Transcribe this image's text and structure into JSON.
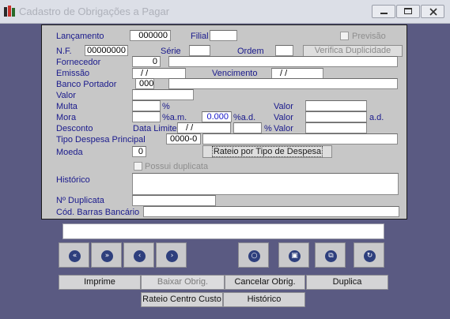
{
  "window": {
    "title": "Cadastro de Obrigações a Pagar",
    "minimize_icon": "minimize-icon",
    "maximize_icon": "maximize-icon",
    "close_icon": "close-icon"
  },
  "form": {
    "lancamento": {
      "label": "Lançamento",
      "value": "000000"
    },
    "filial": {
      "label": "Filial",
      "value": ""
    },
    "previsao": {
      "label": "Previsão",
      "checked": false
    },
    "nf": {
      "label": "N.F.",
      "value": "00000000"
    },
    "serie": {
      "label": "Série",
      "value": ""
    },
    "ordem": {
      "label": "Ordem",
      "value": ""
    },
    "verifica_label": "Verifica Duplicidade",
    "fornecedor": {
      "label": "Fornecedor",
      "code": "0",
      "name": ""
    },
    "emissao": {
      "label": "Emissão",
      "value": "/ /"
    },
    "vencimento": {
      "label": "Vencimento",
      "value": "/ /"
    },
    "banco": {
      "label": "Banco Portador",
      "code": "000",
      "name": ""
    },
    "valor": {
      "label": "Valor",
      "value": ""
    },
    "multa": {
      "label": "Multa",
      "value": "",
      "pct": "%",
      "valor_label": "Valor",
      "valor_value": ""
    },
    "mora": {
      "label": "Mora",
      "value": "",
      "am": "%a.m.",
      "rate": "0.000",
      "ad": "%a.d.",
      "valor_label": "Valor",
      "valor_value": "",
      "ad2": "a.d."
    },
    "desconto": {
      "label": "Desconto",
      "data_limite_label": "Data Limite",
      "data_limite_value": "/ /",
      "pct_value": "",
      "pct": "%",
      "valor_label": "Valor",
      "valor_value": ""
    },
    "tipo_despesa": {
      "label": "Tipo Despesa Principal",
      "code": "0000-0",
      "name": ""
    },
    "rateio_tipo_label": "Rateio por Tipo de Despesa",
    "moeda": {
      "label": "Moeda",
      "value": "0"
    },
    "possui_duplicata": {
      "label": "Possui duplicata",
      "checked": false
    },
    "historico": {
      "label": "Histórico",
      "value": ""
    },
    "n_duplicata": {
      "label": "Nº Duplicata",
      "value": ""
    },
    "cod_barras": {
      "label": "Cód. Barras Bancário",
      "value": ""
    }
  },
  "status_text": "",
  "nav_buttons": {
    "first": {
      "icon": "first-record-icon",
      "glyph": "«"
    },
    "next_page": {
      "icon": "fast-forward-icon",
      "glyph": "»"
    },
    "prev": {
      "icon": "previous-icon",
      "glyph": "‹"
    },
    "next": {
      "icon": "next-icon",
      "glyph": "›"
    },
    "new": {
      "icon": "new-record-icon",
      "glyph": "○"
    },
    "delete": {
      "icon": "delete-record-icon",
      "glyph": "▣"
    },
    "edit": {
      "icon": "edit-record-icon",
      "glyph": "⧉"
    },
    "refresh": {
      "icon": "refresh-icon",
      "glyph": "↻"
    }
  },
  "action_buttons": {
    "imprime": "Imprime",
    "baixar": "Baixar Obrig.",
    "cancelar": "Cancelar Obrig.",
    "duplica": "Duplica",
    "rateio_centro": "Rateio Centro Custo",
    "historico": "Histórico"
  },
  "colors": {
    "background": "#5a5a82",
    "panel": "#c7c7c7",
    "label": "#1a1a8c",
    "nav_icon": "#2e3f7d"
  }
}
